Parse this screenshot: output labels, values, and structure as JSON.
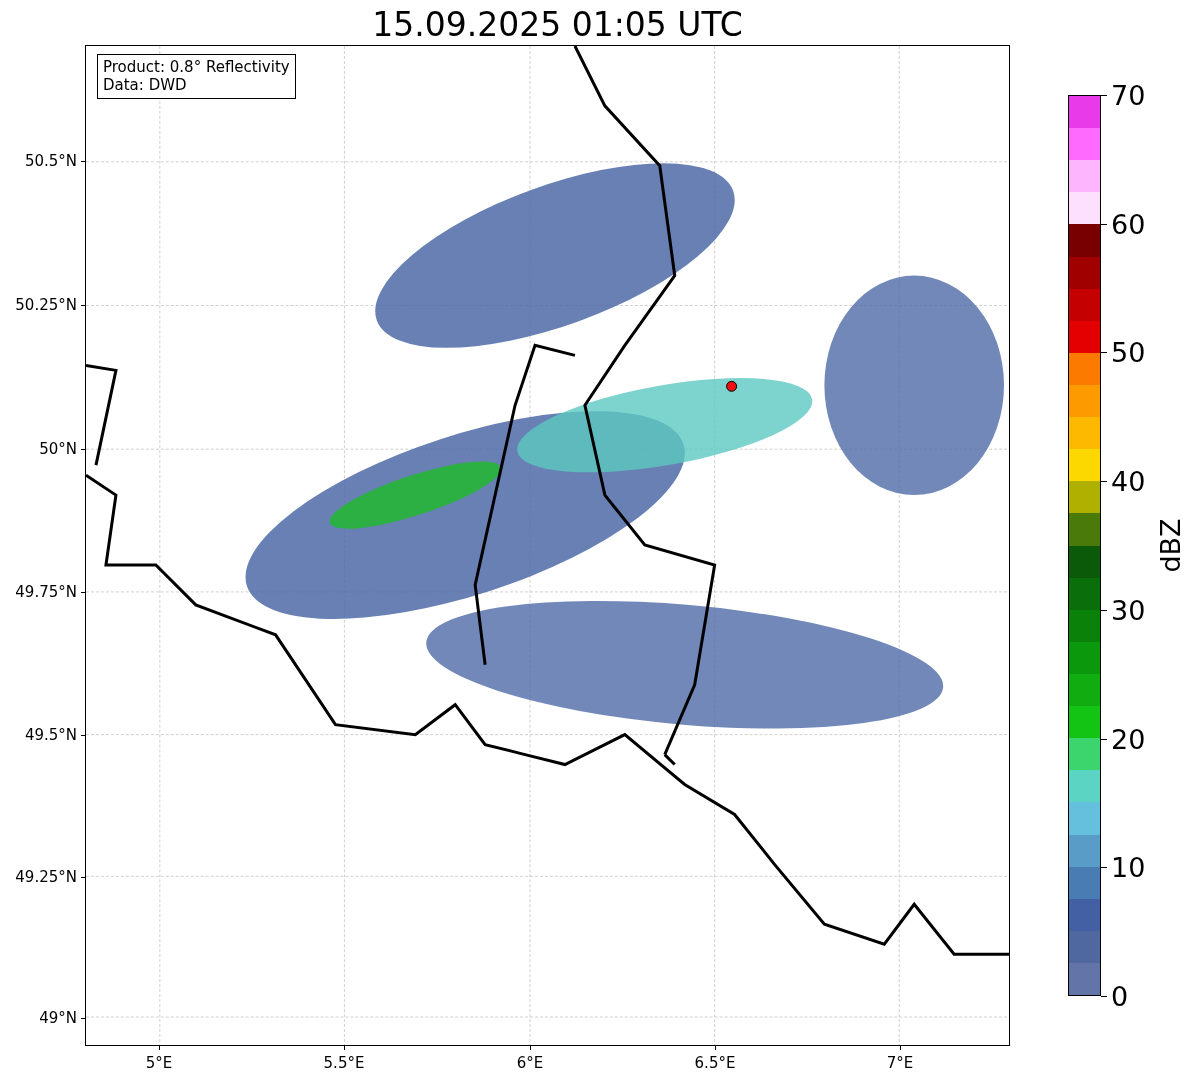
{
  "title": "15.09.2025 01:05 UTC",
  "map": {
    "info_lines": [
      "Product: 0.8° Reflectivity",
      "Data: DWD"
    ],
    "lat_labels": [
      "50.5°N",
      "50.25°N",
      "50°N",
      "49.75°N",
      "49.5°N",
      "49.25°N",
      "49°N"
    ],
    "lon_labels": [
      "5°E",
      "5.5°E",
      "6°E",
      "6.5°E",
      "7°E"
    ]
  },
  "colorbar": {
    "label": "dBZ",
    "ticks": [
      "70",
      "60",
      "50",
      "40",
      "30",
      "20",
      "10",
      "0"
    ],
    "bins": [
      {
        "color": "#e83ae8"
      },
      {
        "color": "#fd6afd"
      },
      {
        "color": "#fdb6fd"
      },
      {
        "color": "#fde0fd"
      },
      {
        "color": "#780000"
      },
      {
        "color": "#a00000"
      },
      {
        "color": "#c40000"
      },
      {
        "color": "#e40000"
      },
      {
        "color": "#fd7a00"
      },
      {
        "color": "#fd9a00"
      },
      {
        "color": "#fdb800"
      },
      {
        "color": "#fdd800"
      },
      {
        "color": "#b0b000"
      },
      {
        "color": "#4a7a0a"
      },
      {
        "color": "#0a5a0a"
      },
      {
        "color": "#0a6e0a"
      },
      {
        "color": "#0a820a"
      },
      {
        "color": "#0c980c"
      },
      {
        "color": "#10ac10"
      },
      {
        "color": "#14c414"
      },
      {
        "color": "#3cd46c"
      },
      {
        "color": "#5cd4c4"
      },
      {
        "color": "#64c0dc"
      },
      {
        "color": "#5a9cc8"
      },
      {
        "color": "#4a7cb4"
      },
      {
        "color": "#4460a4"
      },
      {
        "color": "#5068a0"
      },
      {
        "color": "#6274a8"
      }
    ]
  }
}
